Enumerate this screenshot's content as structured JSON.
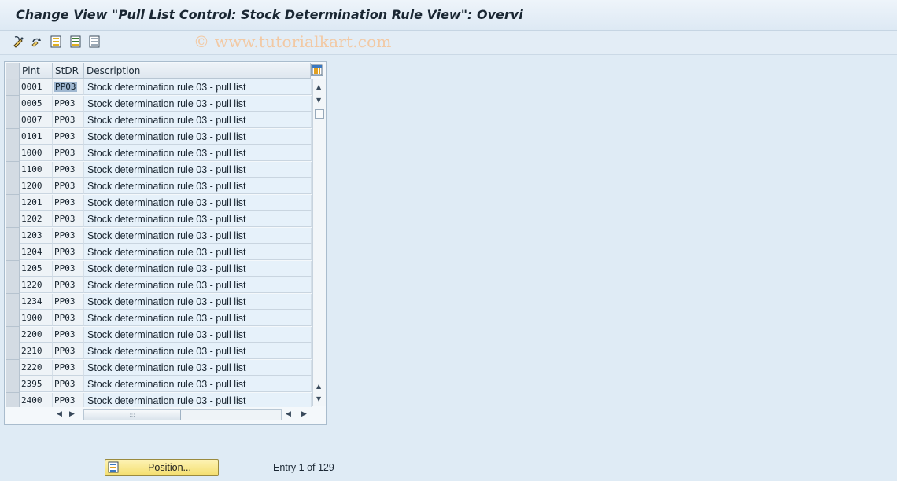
{
  "window": {
    "title": "Change View \"Pull List Control: Stock Determination Rule View\": Overvi"
  },
  "watermark": "© www.tutorialkart.com",
  "toolbar": {
    "icons": [
      "display-change-icon",
      "undo-icon",
      "select-all-icon",
      "select-block-icon",
      "deselect-all-icon"
    ]
  },
  "table": {
    "columns": [
      "Plnt",
      "StDR",
      "Description"
    ],
    "rows": [
      {
        "plant": "0001",
        "rule": "PP03",
        "description": "Stock determination rule 03 - pull list"
      },
      {
        "plant": "0005",
        "rule": "PP03",
        "description": "Stock determination rule 03 - pull list"
      },
      {
        "plant": "0007",
        "rule": "PP03",
        "description": "Stock determination rule 03 - pull list"
      },
      {
        "plant": "0101",
        "rule": "PP03",
        "description": "Stock determination rule 03 - pull list"
      },
      {
        "plant": "1000",
        "rule": "PP03",
        "description": "Stock determination rule 03 - pull list"
      },
      {
        "plant": "1100",
        "rule": "PP03",
        "description": "Stock determination rule 03 - pull list"
      },
      {
        "plant": "1200",
        "rule": "PP03",
        "description": "Stock determination rule 03 - pull list"
      },
      {
        "plant": "1201",
        "rule": "PP03",
        "description": "Stock determination rule 03 - pull list"
      },
      {
        "plant": "1202",
        "rule": "PP03",
        "description": "Stock determination rule 03 - pull list"
      },
      {
        "plant": "1203",
        "rule": "PP03",
        "description": "Stock determination rule 03 - pull list"
      },
      {
        "plant": "1204",
        "rule": "PP03",
        "description": "Stock determination rule 03 - pull list"
      },
      {
        "plant": "1205",
        "rule": "PP03",
        "description": "Stock determination rule 03 - pull list"
      },
      {
        "plant": "1220",
        "rule": "PP03",
        "description": "Stock determination rule 03 - pull list"
      },
      {
        "plant": "1234",
        "rule": "PP03",
        "description": "Stock determination rule 03 - pull list"
      },
      {
        "plant": "1900",
        "rule": "PP03",
        "description": "Stock determination rule 03 - pull list"
      },
      {
        "plant": "2200",
        "rule": "PP03",
        "description": "Stock determination rule 03 - pull list"
      },
      {
        "plant": "2210",
        "rule": "PP03",
        "description": "Stock determination rule 03 - pull list"
      },
      {
        "plant": "2220",
        "rule": "PP03",
        "description": "Stock determination rule 03 - pull list"
      },
      {
        "plant": "2395",
        "rule": "PP03",
        "description": "Stock determination rule 03 - pull list"
      },
      {
        "plant": "2400",
        "rule": "PP03",
        "description": "Stock determination rule 03 - pull list"
      }
    ]
  },
  "footer": {
    "position_button": "Position...",
    "entry_text": "Entry 1 of 129"
  }
}
